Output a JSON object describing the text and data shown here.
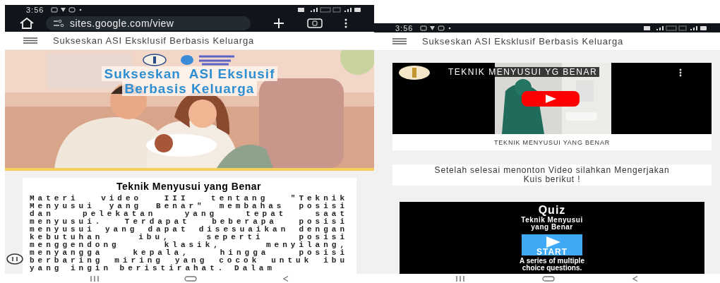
{
  "left_screen": {
    "status_bar": {
      "time": "3:56"
    },
    "address_bar": {
      "url": "sites.google.com/view"
    },
    "site_header": {
      "title": "Sukseskan ASI Eksklusif Berbasis Keluarga"
    },
    "banner": {
      "kind": "picture",
      "title_lines": [
        "Sukseskan  ASI Ekslusif",
        "Berbasis Keluarga"
      ]
    },
    "article": {
      "heading": "Teknik Menyusui yang Benar",
      "body": "Materi video III tentang \"Teknik Menyusui yang Benar\" membahas posisi dan pelekatan yang tepat saat menyusui. Terdapat beberapa posisi menyusui yang dapat disesuaikan dengan kebutuhan ibu, seperti posisi menggendong klasik, menyilang, menyangga kepala, hingga posisi berbaring miring yang cocok untuk ibu yang ingin beristirahat. Dalam"
    }
  },
  "right_screen": {
    "status_bar": {
      "time": "3:56"
    },
    "site_header": {
      "title": "Sukseskan ASI Eksklusif Berbasis Keluarga"
    },
    "video": {
      "title": "TEKNIK MENYUSUI YG BENAR",
      "caption": "TEKNIK MENYUSUI YANG BENAR"
    },
    "notice": "Setelah selesai menonton Video silahkan Mengerjakan Kuis berikut !",
    "quiz": {
      "title": "Quiz",
      "subtitle": "Teknik Menyusui yang Benar",
      "button": "START",
      "description": "A series of multiple choice questions."
    }
  }
}
